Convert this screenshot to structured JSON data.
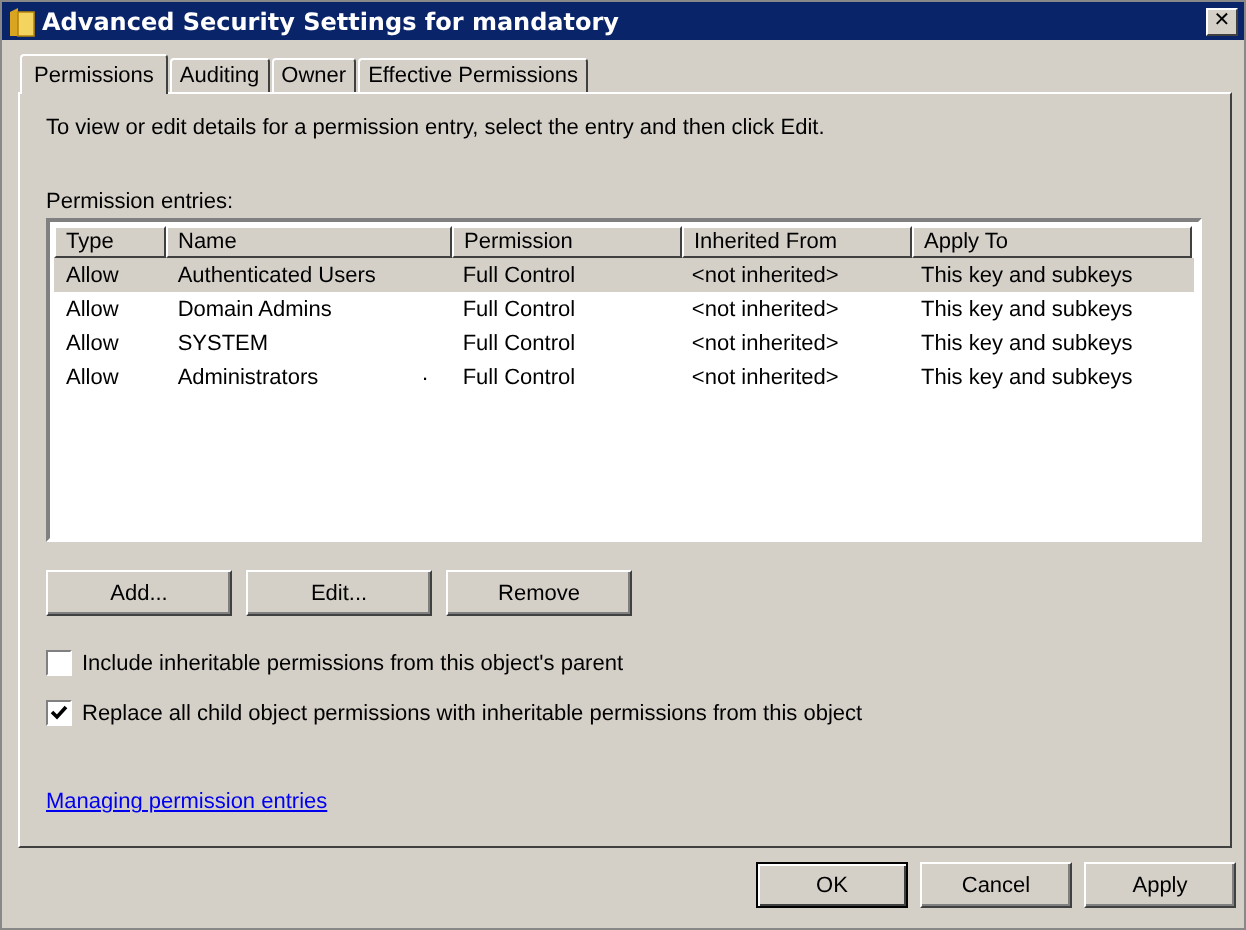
{
  "window": {
    "title": "Advanced Security Settings for mandatory",
    "close": "✕"
  },
  "tabs": [
    {
      "label": "Permissions",
      "selected": true
    },
    {
      "label": "Auditing",
      "selected": false
    },
    {
      "label": "Owner",
      "selected": false
    },
    {
      "label": "Effective Permissions",
      "selected": false
    }
  ],
  "intro": "To view or edit details for a permission entry, select the entry and then click Edit.",
  "entries_label": "Permission entries:",
  "table": {
    "columns": [
      "Type",
      "Name",
      "Permission",
      "Inherited From",
      "Apply To"
    ],
    "rows": [
      {
        "cells": [
          "Allow",
          "Authenticated Users",
          "Full Control",
          "<not inherited>",
          "This key and subkeys"
        ],
        "selected": true
      },
      {
        "cells": [
          "Allow",
          "Domain Admins",
          "Full Control",
          "<not inherited>",
          "This key and subkeys"
        ],
        "selected": false
      },
      {
        "cells": [
          "Allow",
          "SYSTEM",
          "Full Control",
          "<not inherited>",
          "This key and subkeys"
        ],
        "selected": false
      },
      {
        "cells": [
          "Allow",
          "Administrators",
          "Full Control",
          "<not inherited>",
          "This key and subkeys"
        ],
        "selected": false,
        "stray_mark": "."
      }
    ]
  },
  "entry_buttons": [
    "Add...",
    "Edit...",
    "Remove"
  ],
  "checkboxes": [
    {
      "label": "Include inheritable permissions from this object's parent",
      "checked": false
    },
    {
      "label": "Replace all child object permissions with inheritable permissions from this object",
      "checked": true
    }
  ],
  "help_link": "Managing permission entries",
  "dialog_buttons": [
    {
      "label": "OK",
      "default": true
    },
    {
      "label": "Cancel",
      "default": false
    },
    {
      "label": "Apply",
      "default": false
    }
  ]
}
